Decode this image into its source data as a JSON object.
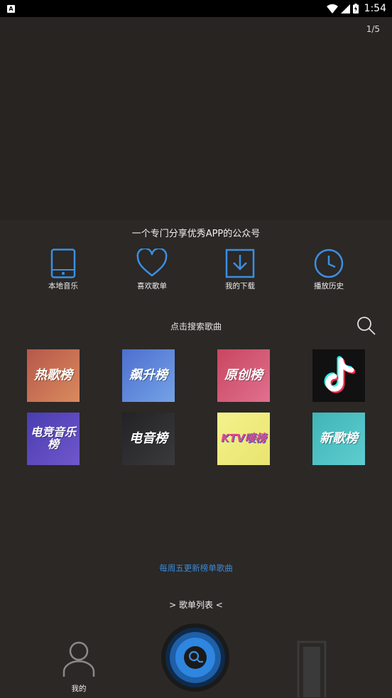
{
  "status_bar": {
    "time": "1:54",
    "notification_icon": "A"
  },
  "banner": {
    "counter": "1/5"
  },
  "main": {
    "headline": "一个专门分享优秀APP的公众号",
    "quick_actions": [
      {
        "label": "本地音乐",
        "icon": "tablet-icon"
      },
      {
        "label": "喜欢歌单",
        "icon": "heart-icon"
      },
      {
        "label": "我的下载",
        "icon": "download-icon"
      },
      {
        "label": "播放历史",
        "icon": "clock-icon"
      }
    ],
    "search_hint": "点击搜索歌曲",
    "charts": [
      {
        "name": "热歌榜",
        "color": "#c96a4f"
      },
      {
        "name": "飙升榜",
        "color": "#5b85d6"
      },
      {
        "name": "原创榜",
        "color": "#d6567a"
      },
      {
        "name": "抖音",
        "color": "#111111"
      },
      {
        "name": "电竞音乐榜",
        "color": "#5a45b8"
      },
      {
        "name": "电音榜",
        "color": "#2c2c2e"
      },
      {
        "name": "KTV唛榜",
        "color": "#f0ef8a"
      },
      {
        "name": "新歌榜",
        "color": "#4ebfc2"
      }
    ],
    "weekly_note": "每周五更新榜单歌曲",
    "playlist_link": "> 歌单列表 <"
  },
  "bottom_nav": {
    "mine_label": "我的"
  }
}
